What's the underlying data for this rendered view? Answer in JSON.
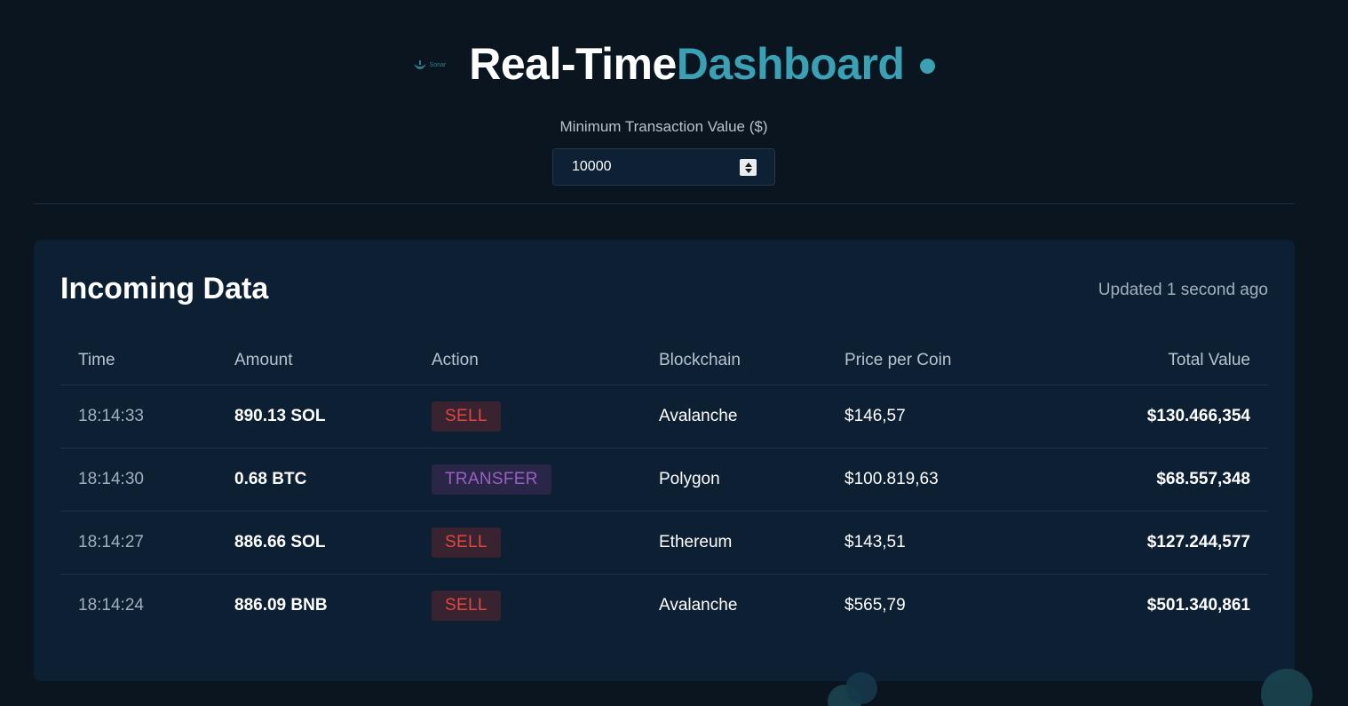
{
  "header": {
    "logo_text": "Sonar",
    "title_main": "Real-Time",
    "title_accent": "Dashboard",
    "accent_color": "#3aa0b3"
  },
  "filter": {
    "label": "Minimum Transaction Value ($)",
    "value": "10000"
  },
  "panel": {
    "title": "Incoming Data",
    "updated": "Updated 1 second ago"
  },
  "table": {
    "columns": [
      "Time",
      "Amount",
      "Action",
      "Blockchain",
      "Price per Coin",
      "Total Value"
    ],
    "rows": [
      {
        "time": "18:14:33",
        "amount": "890.13 SOL",
        "action": "SELL",
        "blockchain": "Avalanche",
        "price": "$146,57",
        "total": "$130.466,354"
      },
      {
        "time": "18:14:30",
        "amount": "0.68 BTC",
        "action": "TRANSFER",
        "blockchain": "Polygon",
        "price": "$100.819,63",
        "total": "$68.557,348"
      },
      {
        "time": "18:14:27",
        "amount": "886.66 SOL",
        "action": "SELL",
        "blockchain": "Ethereum",
        "price": "$143,51",
        "total": "$127.244,577"
      },
      {
        "time": "18:14:24",
        "amount": "886.09 BNB",
        "action": "SELL",
        "blockchain": "Avalanche",
        "price": "$565,79",
        "total": "$501.340,861"
      }
    ]
  },
  "action_colors": {
    "SELL": "#e0473f",
    "TRANSFER": "#9b5fc6"
  }
}
